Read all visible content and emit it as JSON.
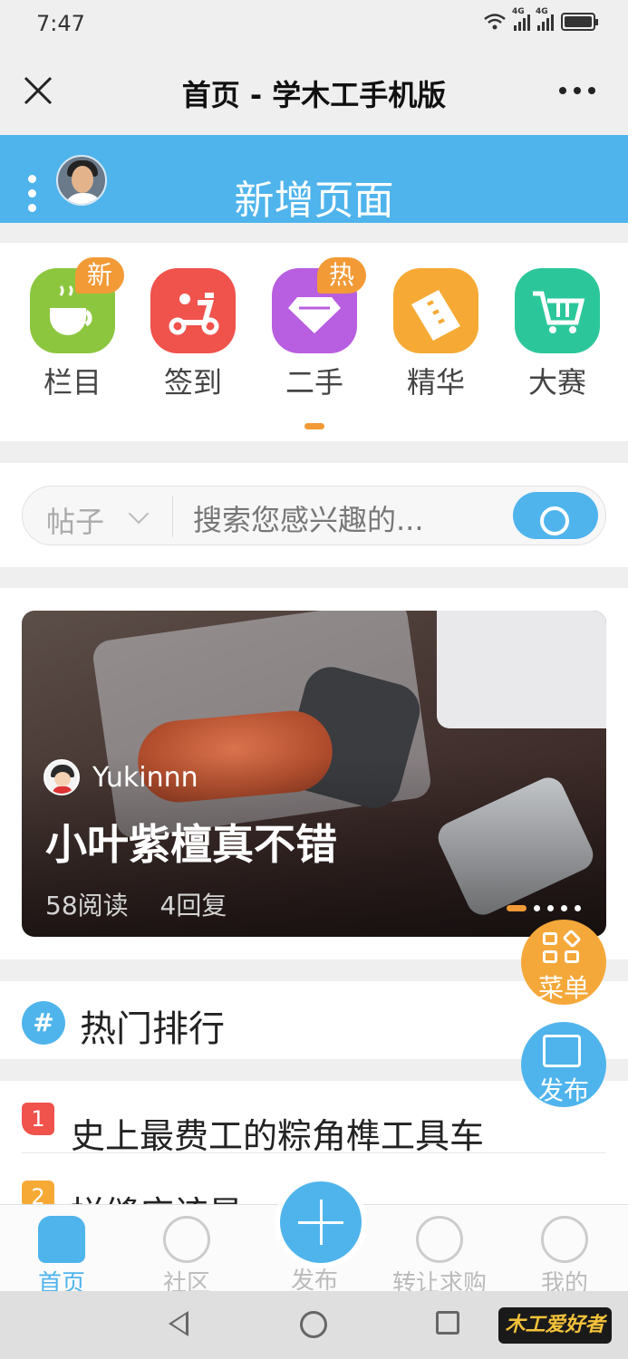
{
  "status_bar": {
    "time": "7:47",
    "net1": "4G",
    "net2": "4G"
  },
  "titlebar": {
    "title": "首页 - 学木工手机版"
  },
  "app_header": {
    "title": "新增页面"
  },
  "categories": [
    {
      "label": "栏目",
      "icon": "cup-icon",
      "color": "#8cc63f",
      "badge": "新"
    },
    {
      "label": "签到",
      "icon": "scooter-icon",
      "color": "#f0524c",
      "badge": ""
    },
    {
      "label": "二手",
      "icon": "diamond-icon",
      "color": "#b85ee0",
      "badge": "热"
    },
    {
      "label": "精华",
      "icon": "ticket-icon",
      "color": "#f6aa35",
      "badge": ""
    },
    {
      "label": "大赛",
      "icon": "cart-icon",
      "color": "#2bc79a",
      "badge": ""
    }
  ],
  "search": {
    "scope": "帖子",
    "placeholder": "搜索您感兴趣的..."
  },
  "banner": {
    "author": "Yukinnn",
    "headline": "小叶紫檀真不错",
    "reads": "58阅读",
    "replies": "4回复"
  },
  "hot": {
    "heading": "热门排行",
    "items": [
      {
        "rank": "1",
        "title": "史上最费工的粽角榫工具车",
        "color": "#f0524c"
      },
      {
        "rank": "2",
        "title": "拼缝应该是...",
        "color": "#f6aa35"
      }
    ]
  },
  "floating": {
    "menu_label": "菜单",
    "publish_label": "发布"
  },
  "bottom_nav": {
    "home": "首页",
    "community": "社区",
    "publish": "发布",
    "transfer": "转让求购",
    "mine": "我的"
  },
  "watermark": "木工爱好者"
}
